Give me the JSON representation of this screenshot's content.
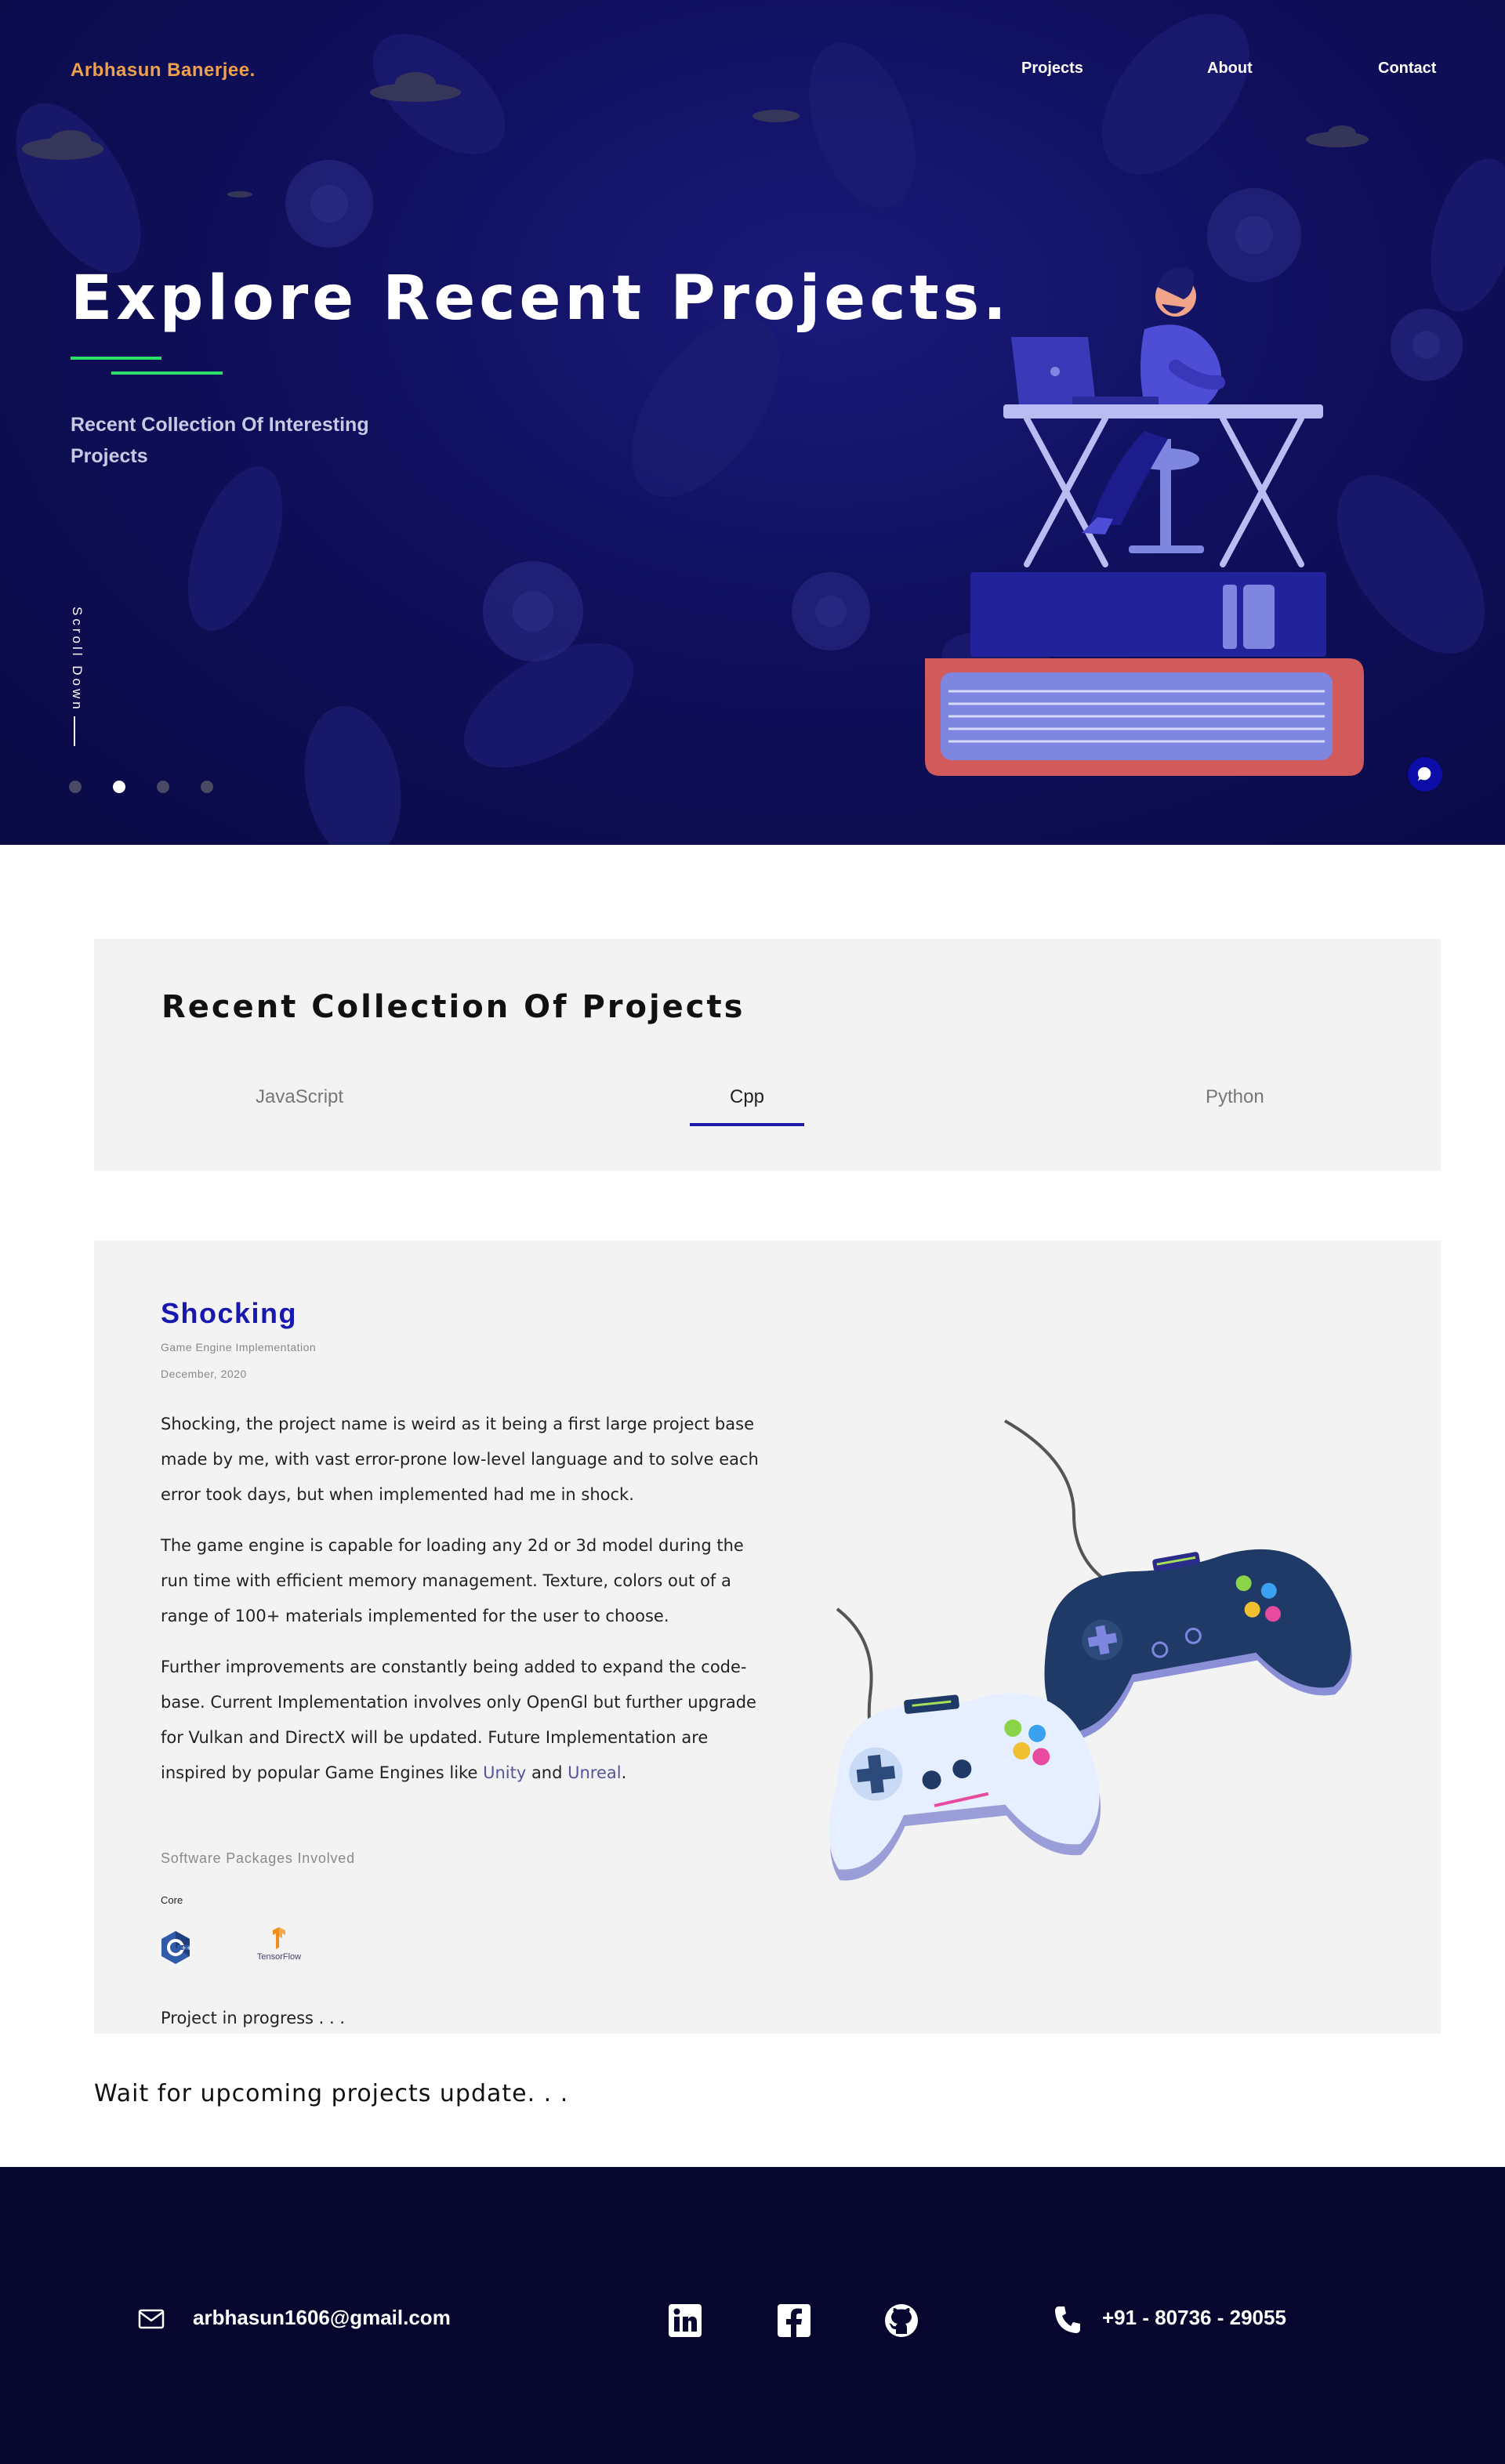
{
  "header": {
    "logo": "Arbhasun Banerjee.",
    "nav": [
      "Projects",
      "About",
      "Contact"
    ]
  },
  "hero": {
    "title": "Explore Recent Projects.",
    "subtitle": "Recent Collection Of Interesting Projects",
    "scroll_label": "Scroll Down",
    "slide_count": 4,
    "active_slide": 2
  },
  "collection": {
    "title": "Recent Collection Of Projects",
    "tabs": [
      "JavaScript",
      "Cpp",
      "Python"
    ],
    "active_tab": "Cpp"
  },
  "project": {
    "title": "Shocking",
    "subtitle": "Game Engine Implementation",
    "date": "December, 2020",
    "para1": "Shocking, the project name is weird as it being a first large project base made by me, with vast error-prone low-level language and to solve each error took days, but when implemented had me in shock.",
    "para2": "The game engine is capable for loading any 2d or 3d model during the run time with efficient memory management. Texture, colors out of a range of 100+ materials implemented for the user to choose.",
    "para3_a": "Further improvements are constantly being added to expand the code-base. Current Implementation involves only OpenGl but further upgrade for Vulkan and DirectX will be updated. Future Implementation are inspired by popular Game Engines like ",
    "para3_link1": "Unity",
    "para3_and": " and ",
    "para3_link2": "Unreal",
    "para3_end": ".",
    "packages_label": "Software Packages Involved",
    "core_label": "Core",
    "packages": [
      "C++",
      "TensorFlow"
    ],
    "tensorflow_label": "TensorFlow",
    "status": "Project in progress . . ."
  },
  "upcoming": "Wait for upcoming projects update. . .",
  "footer": {
    "email": "arbhasun1606@gmail.com",
    "phone": "+91 - 80736 - 29055",
    "socials": [
      "linkedin-icon",
      "facebook-icon",
      "github-icon"
    ]
  },
  "colors": {
    "hero_bg": "#0f0f5c",
    "accent_orange": "#f0a04b",
    "accent_green": "#2ee06a",
    "project_title": "#1818b0",
    "footer_bg": "#06062e"
  }
}
